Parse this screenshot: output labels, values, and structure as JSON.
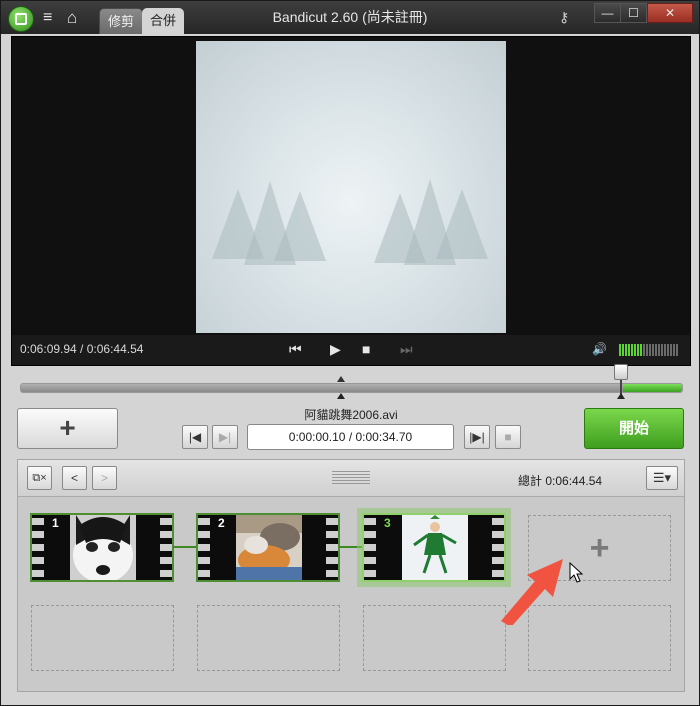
{
  "titlebar": {
    "title": "Bandicut 2.60 (尚未註冊)",
    "tabs": [
      {
        "label": "修剪"
      },
      {
        "label": "合併"
      }
    ],
    "icons": {
      "menu": "≡",
      "home": "⌂",
      "key": "⚷"
    },
    "window_buttons": {
      "minimize": "—",
      "maximize": "☐",
      "close": "✕"
    }
  },
  "player": {
    "timecode": "0:06:09.94 / 0:06:44.54",
    "icons": {
      "prev": "⏮",
      "play": "▶",
      "stop": "■",
      "next": "⏭",
      "volume": "🔊"
    },
    "volume_level": 0.4
  },
  "timeline": {
    "progress_fraction": 0.91
  },
  "controls": {
    "add_label": "+",
    "filename": "阿貓跳舞2006.avi",
    "btn_start_mark": "|◀",
    "btn_end_mark": "▶|",
    "time_value": "0:00:00.10 / 0:00:34.70",
    "btn_play_range": "|▶|",
    "btn_stop_range": "■",
    "start_label": "開始"
  },
  "list": {
    "total": "總計 0:06:44.54",
    "tool_icons": {
      "remove": "⧉×",
      "prev": "<",
      "next": ">",
      "menu": "☰▾"
    },
    "clips": [
      {
        "number": "1",
        "subject": "cat"
      },
      {
        "number": "2",
        "subject": "cats"
      },
      {
        "number": "3",
        "subject": "dancer"
      }
    ],
    "add_slot_label": "+"
  },
  "colors": {
    "accent": "#3e9e1e",
    "start_button": "#5cbf34",
    "panel": "#c9c9c9"
  }
}
